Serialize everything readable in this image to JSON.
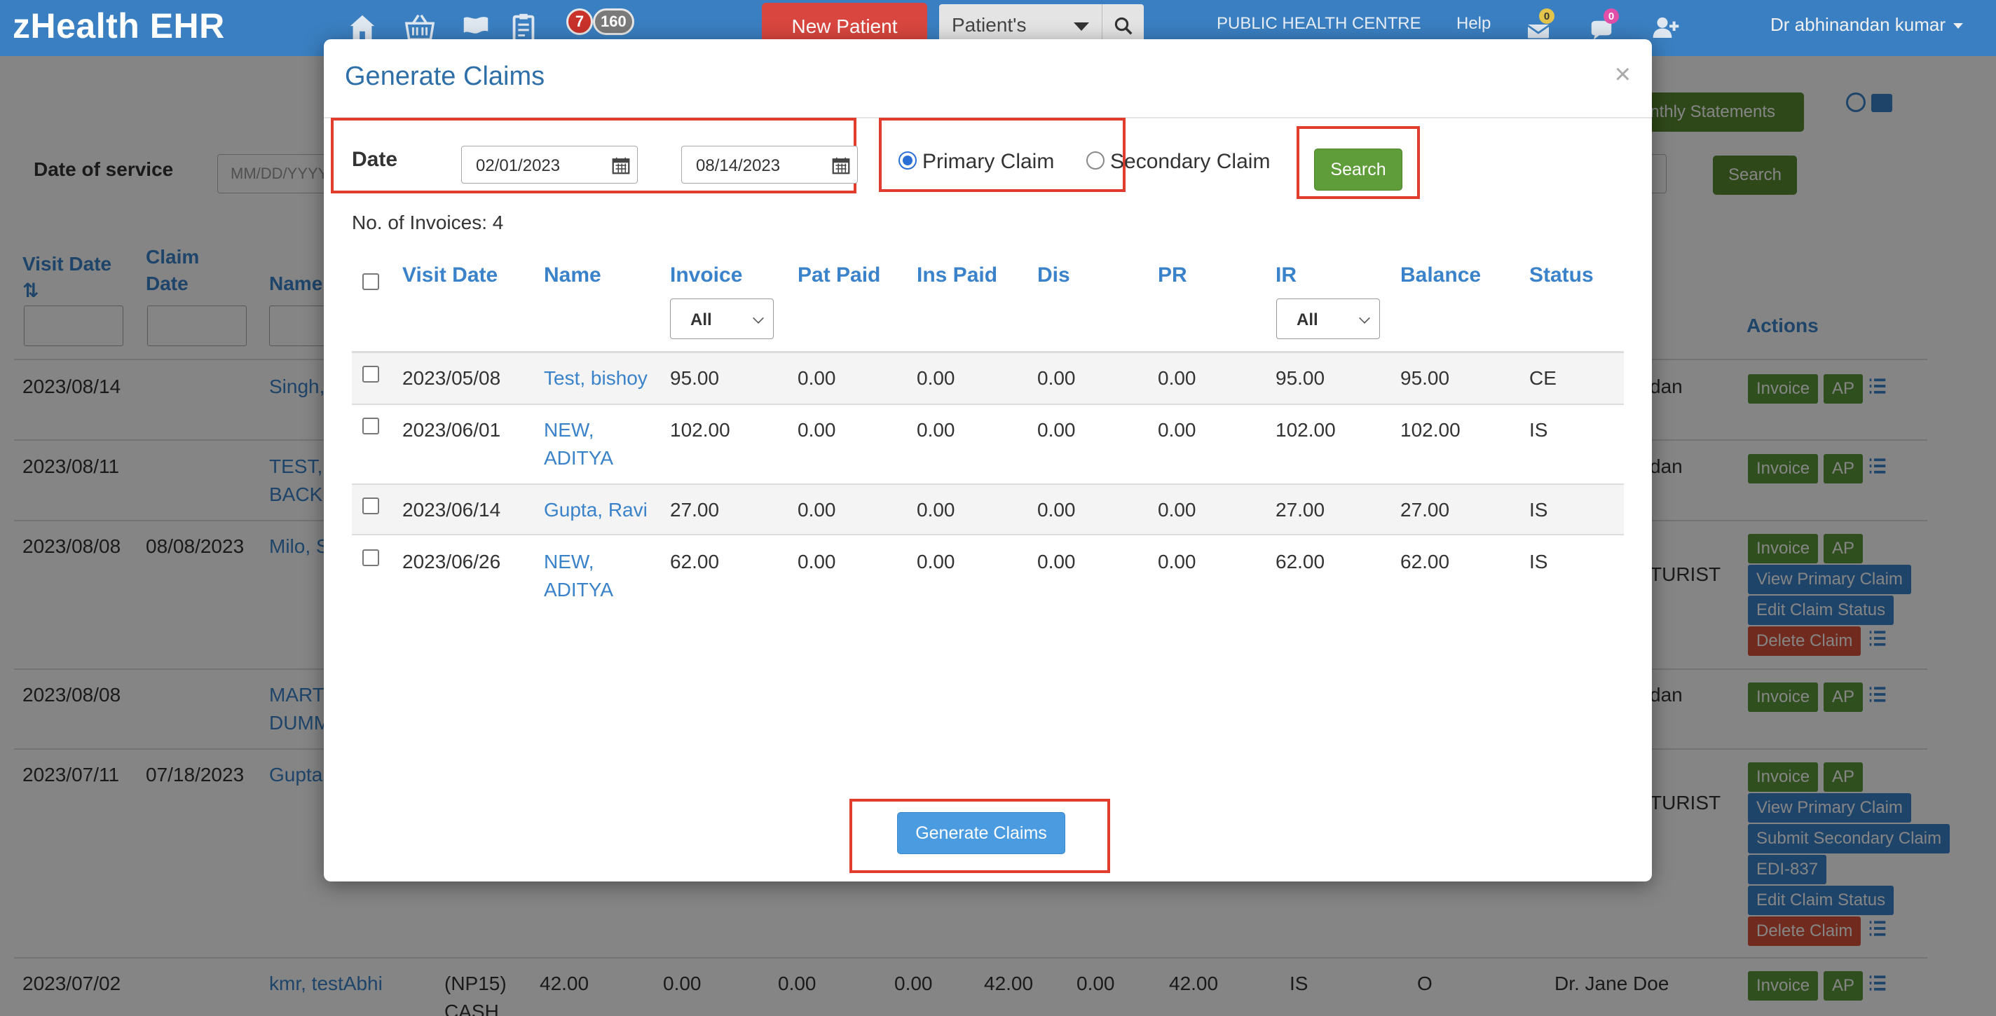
{
  "navbar": {
    "brand": "zHealth EHR",
    "badge_red": "7",
    "badge_gray": "160",
    "new_patient_label": "New Patient",
    "patient_select": "Patient's",
    "centre": "PUBLIC HEALTH CENTRE",
    "help": "Help",
    "messages_count": "0",
    "chat_count": "0",
    "user": "Dr abhinandan kumar"
  },
  "background": {
    "monthly_statements": "onthly Statements",
    "date_of_service_label": "Date of service",
    "date_placeholder": "MM/DD/YYYY",
    "search_label": "Search",
    "headers": {
      "visit_date": "Visit Date",
      "claim_date_1": "Claim",
      "claim_date_2": "Date",
      "name": "Name",
      "actions": "Actions"
    },
    "rows": [
      {
        "visit": "2023/08/14",
        "claim": "",
        "name_1": "Singh,",
        "name_2": "",
        "provider": "dan"
      },
      {
        "visit": "2023/08/11",
        "claim": "",
        "name_1": "TEST,",
        "name_2": "BACK",
        "provider": "dan"
      },
      {
        "visit": "2023/08/08",
        "claim": "08/08/2023",
        "name_1": "Milo, S",
        "name_2": "",
        "provider": "TURIST"
      },
      {
        "visit": "2023/08/08",
        "claim": "",
        "name_1": "MART",
        "name_2": "DUMM",
        "provider": "dan"
      },
      {
        "visit": "2023/07/11",
        "claim": "07/18/2023",
        "name_1": "Gupta",
        "name_2": "",
        "provider": "TURIST"
      }
    ],
    "last_row": {
      "visit": "2023/07/02",
      "name": "kmr, testAbhi",
      "type_1": "(NP15)",
      "type_2": "CASH",
      "v1": "42.00",
      "v2": "0.00",
      "v3": "0.00",
      "v4": "0.00",
      "v5": "42.00",
      "v6": "0.00",
      "v7": "42.00",
      "status": "IS",
      "flag": "O",
      "provider": "Dr. Jane Doe"
    },
    "actions": {
      "invoice": "Invoice",
      "ap": "AP",
      "view_primary": "View Primary Claim",
      "edit_status": "Edit Claim Status",
      "delete": "Delete Claim",
      "submit_secondary": "Submit Secondary Claim",
      "edi": "EDI-837"
    }
  },
  "modal": {
    "title": "Generate Claims",
    "close": "×",
    "date_label": "Date",
    "date_from": "02/01/2023",
    "date_to": "08/14/2023",
    "primary_claim": "Primary Claim",
    "secondary_claim": "Secondary Claim",
    "search_label": "Search",
    "invoice_count": "No. of Invoices: 4",
    "columns": {
      "visit_date": "Visit Date",
      "name": "Name",
      "invoice": "Invoice",
      "pat_paid": "Pat Paid",
      "ins_paid": "Ins Paid",
      "dis": "Dis",
      "pr": "PR",
      "ir": "IR",
      "balance": "Balance",
      "status": "Status"
    },
    "invoice_filter": "All",
    "ir_filter": "All",
    "rows": [
      {
        "visit_date": "2023/05/08",
        "name_1": "Test, bishoy",
        "name_2": "",
        "invoice": "95.00",
        "pat_paid": "0.00",
        "ins_paid": "0.00",
        "dis": "0.00",
        "pr": "0.00",
        "ir": "95.00",
        "balance": "95.00",
        "status": "CE"
      },
      {
        "visit_date": "2023/06/01",
        "name_1": "NEW,",
        "name_2": "ADITYA",
        "invoice": "102.00",
        "pat_paid": "0.00",
        "ins_paid": "0.00",
        "dis": "0.00",
        "pr": "0.00",
        "ir": "102.00",
        "balance": "102.00",
        "status": "IS"
      },
      {
        "visit_date": "2023/06/14",
        "name_1": "Gupta, Ravi",
        "name_2": "",
        "invoice": "27.00",
        "pat_paid": "0.00",
        "ins_paid": "0.00",
        "dis": "0.00",
        "pr": "0.00",
        "ir": "27.00",
        "balance": "27.00",
        "status": "IS"
      },
      {
        "visit_date": "2023/06/26",
        "name_1": "NEW,",
        "name_2": "ADITYA",
        "invoice": "62.00",
        "pat_paid": "0.00",
        "ins_paid": "0.00",
        "dis": "0.00",
        "pr": "0.00",
        "ir": "62.00",
        "balance": "62.00",
        "status": "IS"
      }
    ],
    "generate_label": "Generate Claims"
  },
  "colors": {
    "navbar": "#3a7fc1",
    "link": "#3a82c9",
    "highlight": "#e03d2f",
    "search_button": "#5f9c3a",
    "generate_button": "#4a9be0",
    "new_patient": "#d9463f"
  },
  "icons": [
    "home-icon",
    "basket-icon",
    "flag-icon",
    "clipboard-icon",
    "search-icon",
    "envelope-icon",
    "chat-icon",
    "add-user-icon",
    "download-icon",
    "print-icon",
    "calendar-icon",
    "list-icon",
    "sort-icon"
  ]
}
